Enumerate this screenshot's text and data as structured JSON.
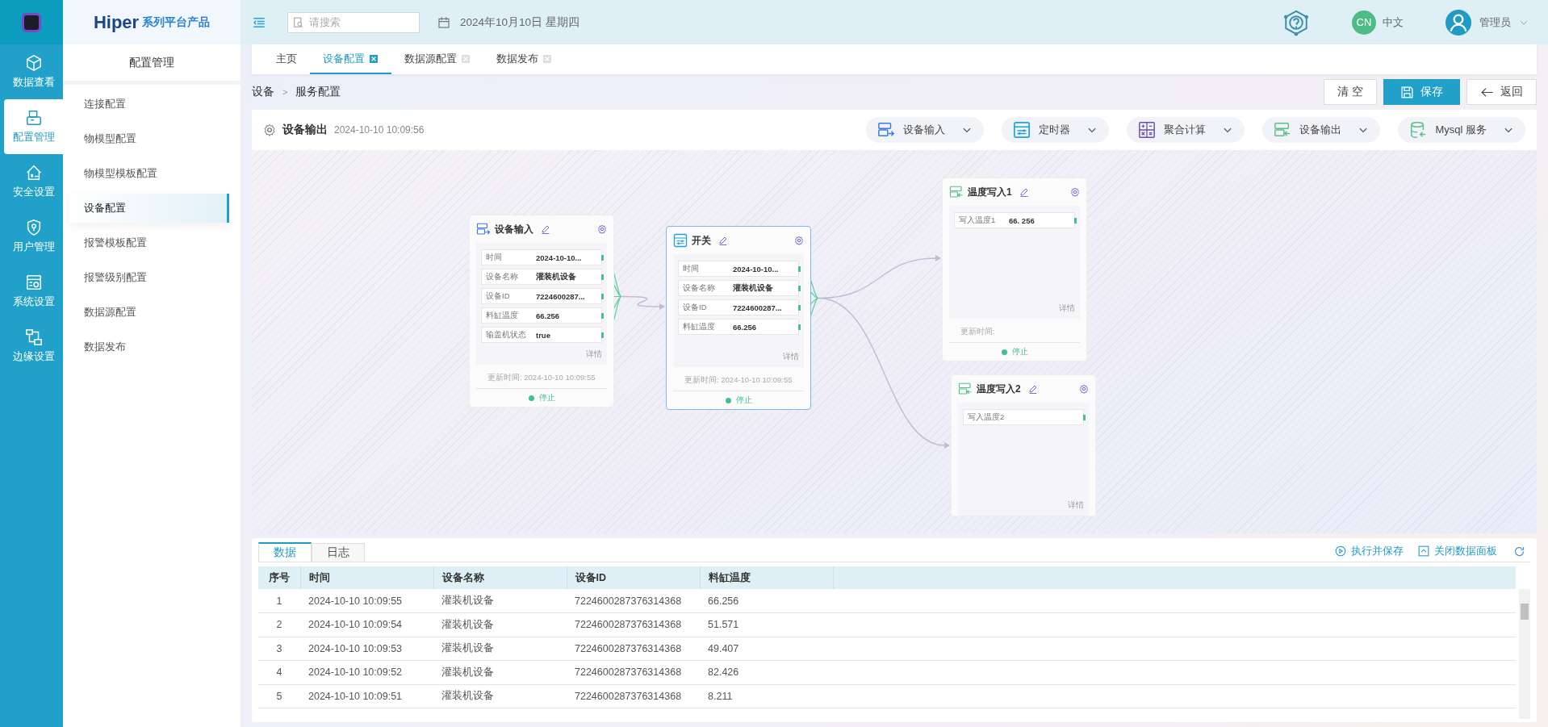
{
  "brand": {
    "name": "Hiper",
    "tagline": "系列平台产品"
  },
  "rail": [
    {
      "label": "数据查看",
      "selected": false
    },
    {
      "label": "配置管理",
      "selected": true
    },
    {
      "label": "安全设置",
      "selected": false
    },
    {
      "label": "用户管理",
      "selected": false
    },
    {
      "label": "系统设置",
      "selected": false
    },
    {
      "label": "边缘设置",
      "selected": false
    }
  ],
  "submenu": {
    "title": "配置管理",
    "items": [
      {
        "label": "连接配置",
        "selected": false
      },
      {
        "label": "物模型配置",
        "selected": false
      },
      {
        "label": "物模型模板配置",
        "selected": false
      },
      {
        "label": "设备配置",
        "selected": true
      },
      {
        "label": "报警模板配置",
        "selected": false
      },
      {
        "label": "报警级别配置",
        "selected": false
      },
      {
        "label": "数据源配置",
        "selected": false
      },
      {
        "label": "数据发布",
        "selected": false
      }
    ]
  },
  "header": {
    "search": {
      "placeholder": "请搜索"
    },
    "date": "2024年10月10日 星期四",
    "language": {
      "badge": "CN",
      "label": "中文"
    },
    "user": "管理员"
  },
  "tabs": [
    {
      "label": "主页",
      "selected": false,
      "closable": false
    },
    {
      "label": "设备配置",
      "selected": true,
      "closable": true
    },
    {
      "label": "数据源配置",
      "selected": false,
      "closable": true
    },
    {
      "label": "数据发布",
      "selected": false,
      "closable": true
    }
  ],
  "breadcrumb": {
    "items": [
      "设备",
      "服务配置"
    ],
    "separator": ">"
  },
  "actions": [
    {
      "label": "清 空",
      "kind": "plain"
    },
    {
      "label": "保存",
      "kind": "primary"
    },
    {
      "label": "返回",
      "kind": "back"
    }
  ],
  "toolbar": {
    "title": "设备输出",
    "time": "2024-10-10 10:09:56",
    "palette": [
      "设备输入",
      "定时器",
      "聚合计算",
      "设备输出",
      "Mysql 服务"
    ]
  },
  "nodes": [
    {
      "title": "设备输入",
      "selected": false,
      "fields": [
        {
          "label": "时间",
          "value": "2024-10-10..."
        },
        {
          "label": "设备名称",
          "value": "灌装机设备"
        },
        {
          "label": "设备ID",
          "value": "7224600287..."
        },
        {
          "label": "料缸温度",
          "value": "66.256"
        },
        {
          "label": "输盖机状态",
          "value": "true"
        }
      ],
      "detail": "详情",
      "update_time": "更新时间: 2024-10-10 10:09:55",
      "status": "停止"
    },
    {
      "title": "开关",
      "selected": true,
      "fields": [
        {
          "label": "时间",
          "value": "2024-10-10..."
        },
        {
          "label": "设备名称",
          "value": "灌装机设备"
        },
        {
          "label": "设备ID",
          "value": "7224600287..."
        },
        {
          "label": "料缸温度",
          "value": "66.256"
        }
      ],
      "detail": "详情",
      "update_time": "更新时间: 2024-10-10 10:09:55",
      "status": "停止"
    },
    {
      "title": "温度写入1",
      "selected": false,
      "fields": [
        {
          "label": "写入温度1",
          "value": "66. 256"
        }
      ],
      "detail": "详情",
      "update_time": "更新时间:",
      "status": "停止"
    },
    {
      "title": "温度写入2",
      "selected": false,
      "fields": [
        {
          "label": "写入温度2"
        }
      ],
      "detail": "详情"
    }
  ],
  "panel": {
    "tabs": [
      {
        "label": "数据",
        "selected": true
      },
      {
        "label": "日志",
        "selected": false
      }
    ],
    "actions": [
      "执行并保存",
      "关闭数据面板"
    ],
    "table": {
      "columns": [
        "序号",
        "时间",
        "设备名称",
        "设备ID",
        "料缸温度"
      ],
      "rows": [
        [
          "1",
          "2024-10-10 10:09:55",
          "灌装机设备",
          "7224600287376314368",
          "66.256"
        ],
        [
          "2",
          "2024-10-10 10:09:54",
          "灌装机设备",
          "7224600287376314368",
          "51.571"
        ],
        [
          "3",
          "2024-10-10 10:09:53",
          "灌装机设备",
          "7224600287376314368",
          "49.407"
        ],
        [
          "4",
          "2024-10-10 10:09:52",
          "灌装机设备",
          "7224600287376314368",
          "82.426"
        ],
        [
          "5",
          "2024-10-10 10:09:51",
          "灌装机设备",
          "7224600287376314368",
          "8.211"
        ]
      ]
    }
  }
}
